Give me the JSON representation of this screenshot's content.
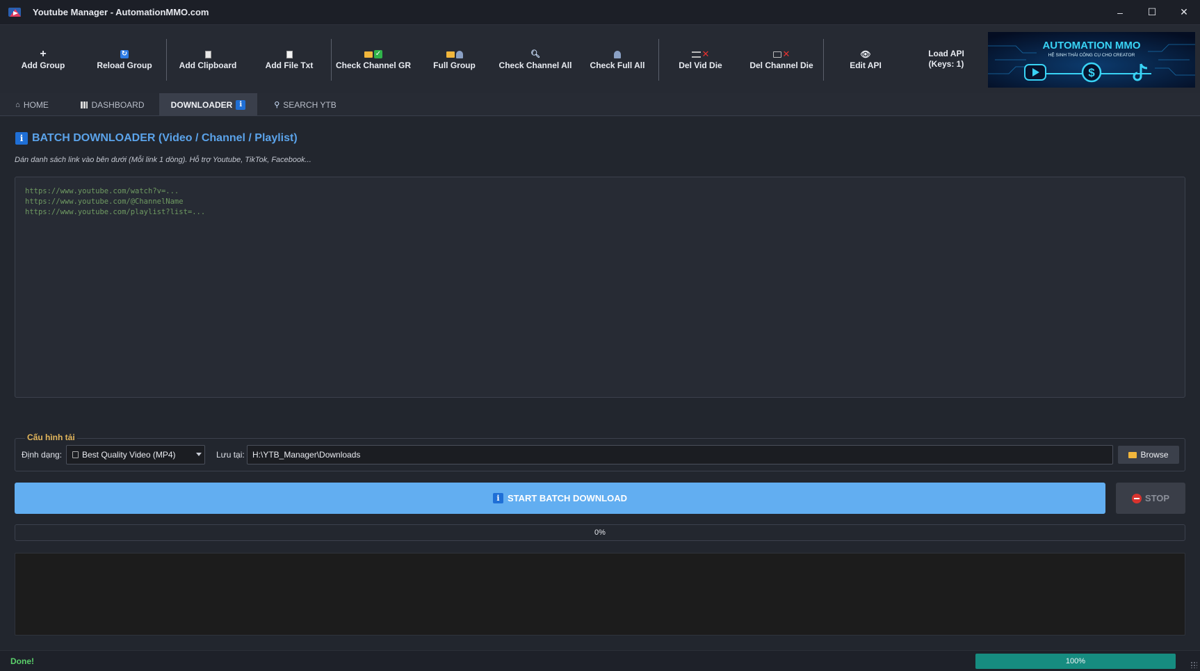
{
  "window": {
    "title": "Youtube Manager - AutomationMMO.com",
    "controls": {
      "minimize": "–",
      "maximize": "☐",
      "close": "✕"
    }
  },
  "toolbar": {
    "buttons": [
      {
        "label": "Add Group",
        "icon": "plus-icon"
      },
      {
        "label": "Reload Group",
        "icon": "refresh-icon"
      },
      {
        "label": "Add Clipboard",
        "icon": "clipboard-icon"
      },
      {
        "label": "Add File Txt",
        "icon": "file-icon"
      },
      {
        "label": "Check Channel GR",
        "icon": "folder-check-icon"
      },
      {
        "label": "Full Group",
        "icon": "folder-user-icon"
      },
      {
        "label": "Check Channel All",
        "icon": "search-icon"
      },
      {
        "label": "Check Full All",
        "icon": "users-icon"
      },
      {
        "label": "Del Vid Die",
        "icon": "list-delete-icon"
      },
      {
        "label": "Del Channel Die",
        "icon": "tv-delete-icon"
      },
      {
        "label": "Edit API",
        "icon": "eye-icon"
      },
      {
        "label": "Load API\n(Keys: 1)",
        "icon": ""
      }
    ],
    "banner": {
      "title": "AUTOMATION MMO",
      "subtitle": "HỆ SINH THÁI CÔNG CỤ CHO CREATOR"
    }
  },
  "tabs": [
    {
      "label": "HOME",
      "icon": "home-icon",
      "active": false
    },
    {
      "label": "DASHBOARD",
      "icon": "chart-icon",
      "active": false
    },
    {
      "label": "DOWNLOADER",
      "icon": "info-icon",
      "active": true
    },
    {
      "label": "SEARCH YTB",
      "icon": "search-icon",
      "active": false
    }
  ],
  "downloader": {
    "title": "BATCH DOWNLOADER (Video / Channel / Playlist)",
    "hint": "Dán danh sách link vào bên dưới (Mỗi link 1 dòng). Hỗ trợ Youtube, TikTok, Facebook...",
    "placeholder": "https://www.youtube.com/watch?v=...\nhttps://www.youtube.com/@ChannelName\nhttps://www.youtube.com/playlist?list=...",
    "config": {
      "legend": "Cấu hình tải",
      "format_label": "Định dạng:",
      "format_value": "Best Quality Video (MP4)",
      "save_label": "Lưu tại:",
      "save_path": "H:\\YTB_Manager\\Downloads",
      "browse_label": "Browse"
    },
    "start_label": "START BATCH DOWNLOAD",
    "stop_label": "STOP",
    "progress": {
      "value": 0,
      "text": "0%"
    },
    "log": ""
  },
  "status": {
    "text": "Done!",
    "progress": {
      "value": 100,
      "text": "100%"
    }
  },
  "colors": {
    "accent": "#62aef1",
    "progress_fill": "#168c80",
    "status_ok": "#5bd06b",
    "legend": "#e3b65c"
  }
}
